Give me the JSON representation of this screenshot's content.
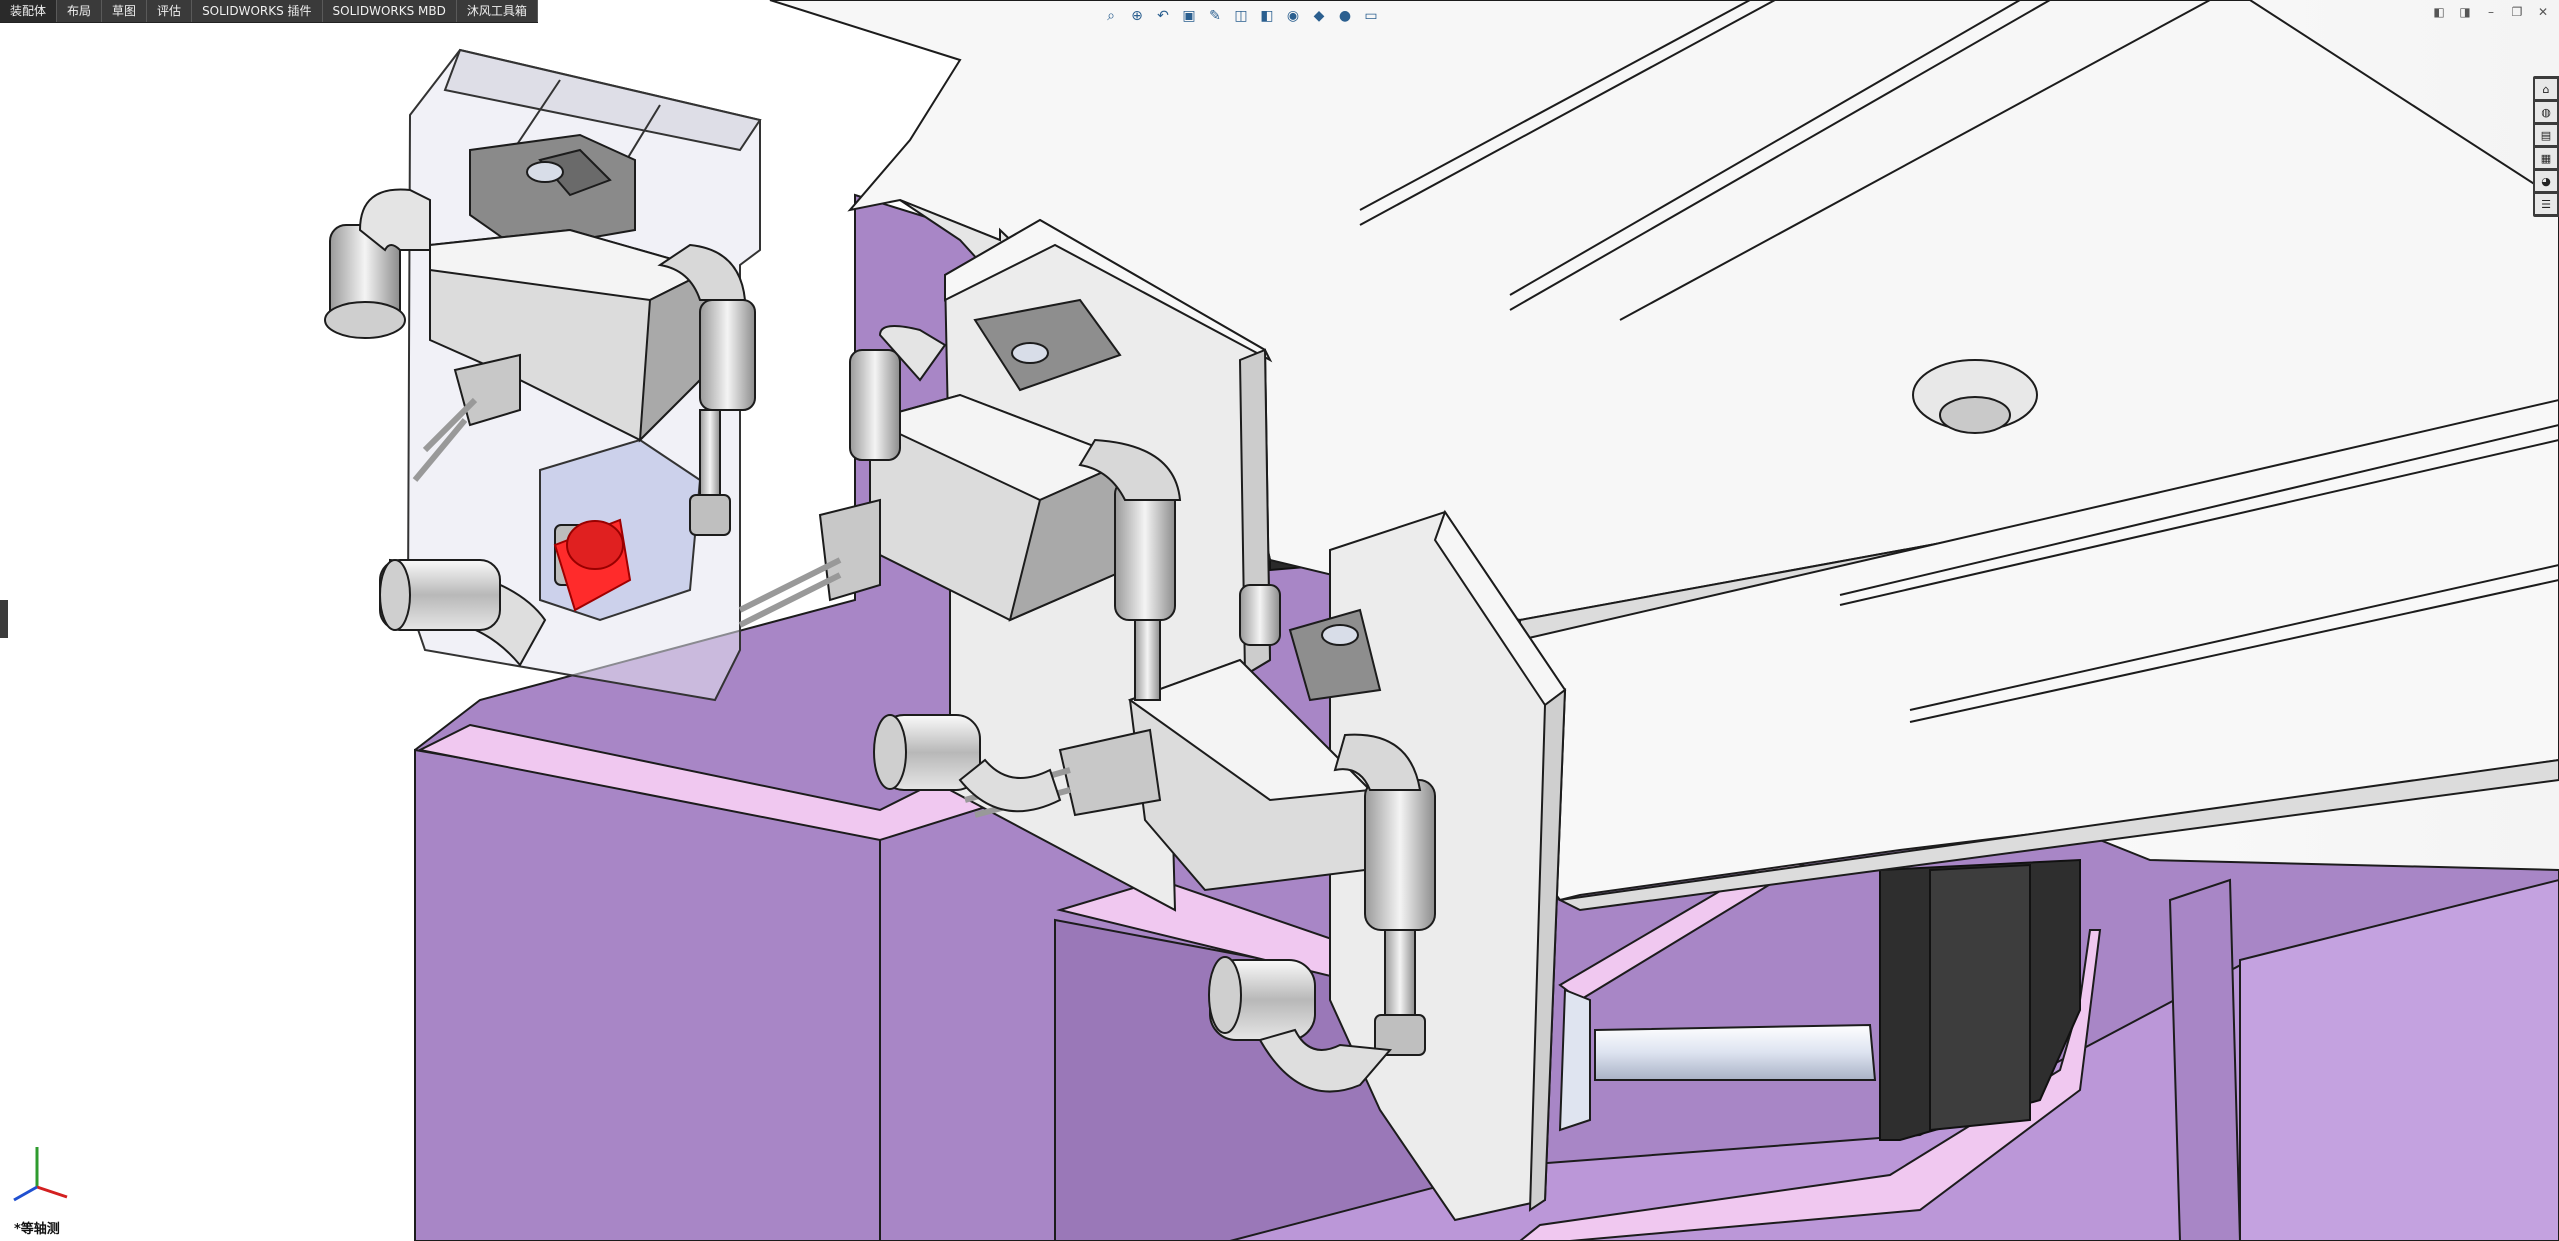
{
  "tabs": [
    "装配体",
    "布局",
    "草图",
    "评估",
    "SOLIDWORKS 插件",
    "SOLIDWORKS MBD",
    "沐风工具箱"
  ],
  "active_tab_index": 0,
  "heads_up_toolbar": [
    "zoom-to-fit-icon",
    "zoom-area-icon",
    "previous-view-icon",
    "section-view-icon",
    "dynamic-annotation-icon",
    "view-orientation-icon",
    "display-style-icon",
    "hide-show-icon",
    "edit-appearance-icon",
    "apply-scene-icon",
    "view-settings-icon"
  ],
  "task_pane": [
    "home-icon",
    "resources-icon",
    "file-explorer-icon",
    "view-palette-icon",
    "appearances-icon",
    "custom-properties-icon"
  ],
  "view_label": "*等轴测",
  "colors": {
    "purple_body": "#a886c6",
    "purple_light": "#c29ee0",
    "purple_pink": "#f0c8f0",
    "dark_block": "#2e2e2e",
    "white_part": "#f7f7f7",
    "part_edge": "#1c1c1c",
    "red_plug": "#e02020"
  }
}
